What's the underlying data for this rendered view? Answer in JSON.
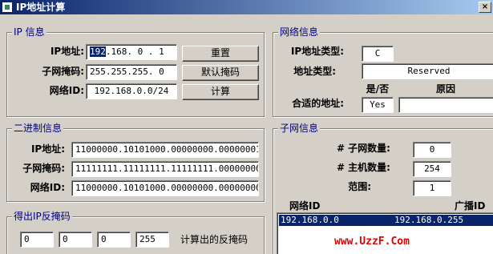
{
  "window": {
    "title": "IP地址计算",
    "close": "×"
  },
  "ip_info": {
    "title": "IP 信息",
    "ip_label": "IP地址:",
    "ip_octets_selected": "192",
    "ip_octets_rest": ".168. 0 . 1",
    "mask_label": "子网掩码:",
    "mask_value": "255.255.255. 0",
    "network_label": "网络ID:",
    "network_value": "192.168.0.0/24",
    "reset_button": "重置",
    "default_mask_button": "默认掩码",
    "calc_button": "计算"
  },
  "network_info": {
    "title": "网络信息",
    "ip_type_label": "IP地址类型:",
    "ip_type_value": "C",
    "address_type_label": "地址类型:",
    "address_type_value": "Reserved",
    "yes_no_header": "是/否",
    "reason_header": "原因",
    "suitable_label": "合适的地址:",
    "suitable_value": "Yes",
    "reason_value": ""
  },
  "binary_info": {
    "title": "二进制信息",
    "ip_label": "IP地址:",
    "ip_value": "11000000.10101000.00000000.00000001",
    "mask_label": "子网掩码:",
    "mask_value": "11111111.11111111.11111111.00000000",
    "network_label": "网络ID:",
    "network_value": "11000000.10101000.00000000.00000000"
  },
  "subnet_info": {
    "title": "子网信息",
    "subnet_count_label": "# 子网数量:",
    "subnet_count_value": "0",
    "host_count_label": "# 主机数量:",
    "host_count_value": "254",
    "range_label": "范围:",
    "range_value": "1",
    "col_network": "网络ID",
    "col_broadcast": "广播ID",
    "rows": [
      {
        "network": "192.168.0.0",
        "broadcast": "192.168.0.255"
      }
    ]
  },
  "wildcard": {
    "title": "得出IP反掩码",
    "octets": [
      "0",
      "0",
      "0",
      "255"
    ],
    "label": "计算出的反掩码"
  },
  "watermark": "www.UzzF.Com"
}
